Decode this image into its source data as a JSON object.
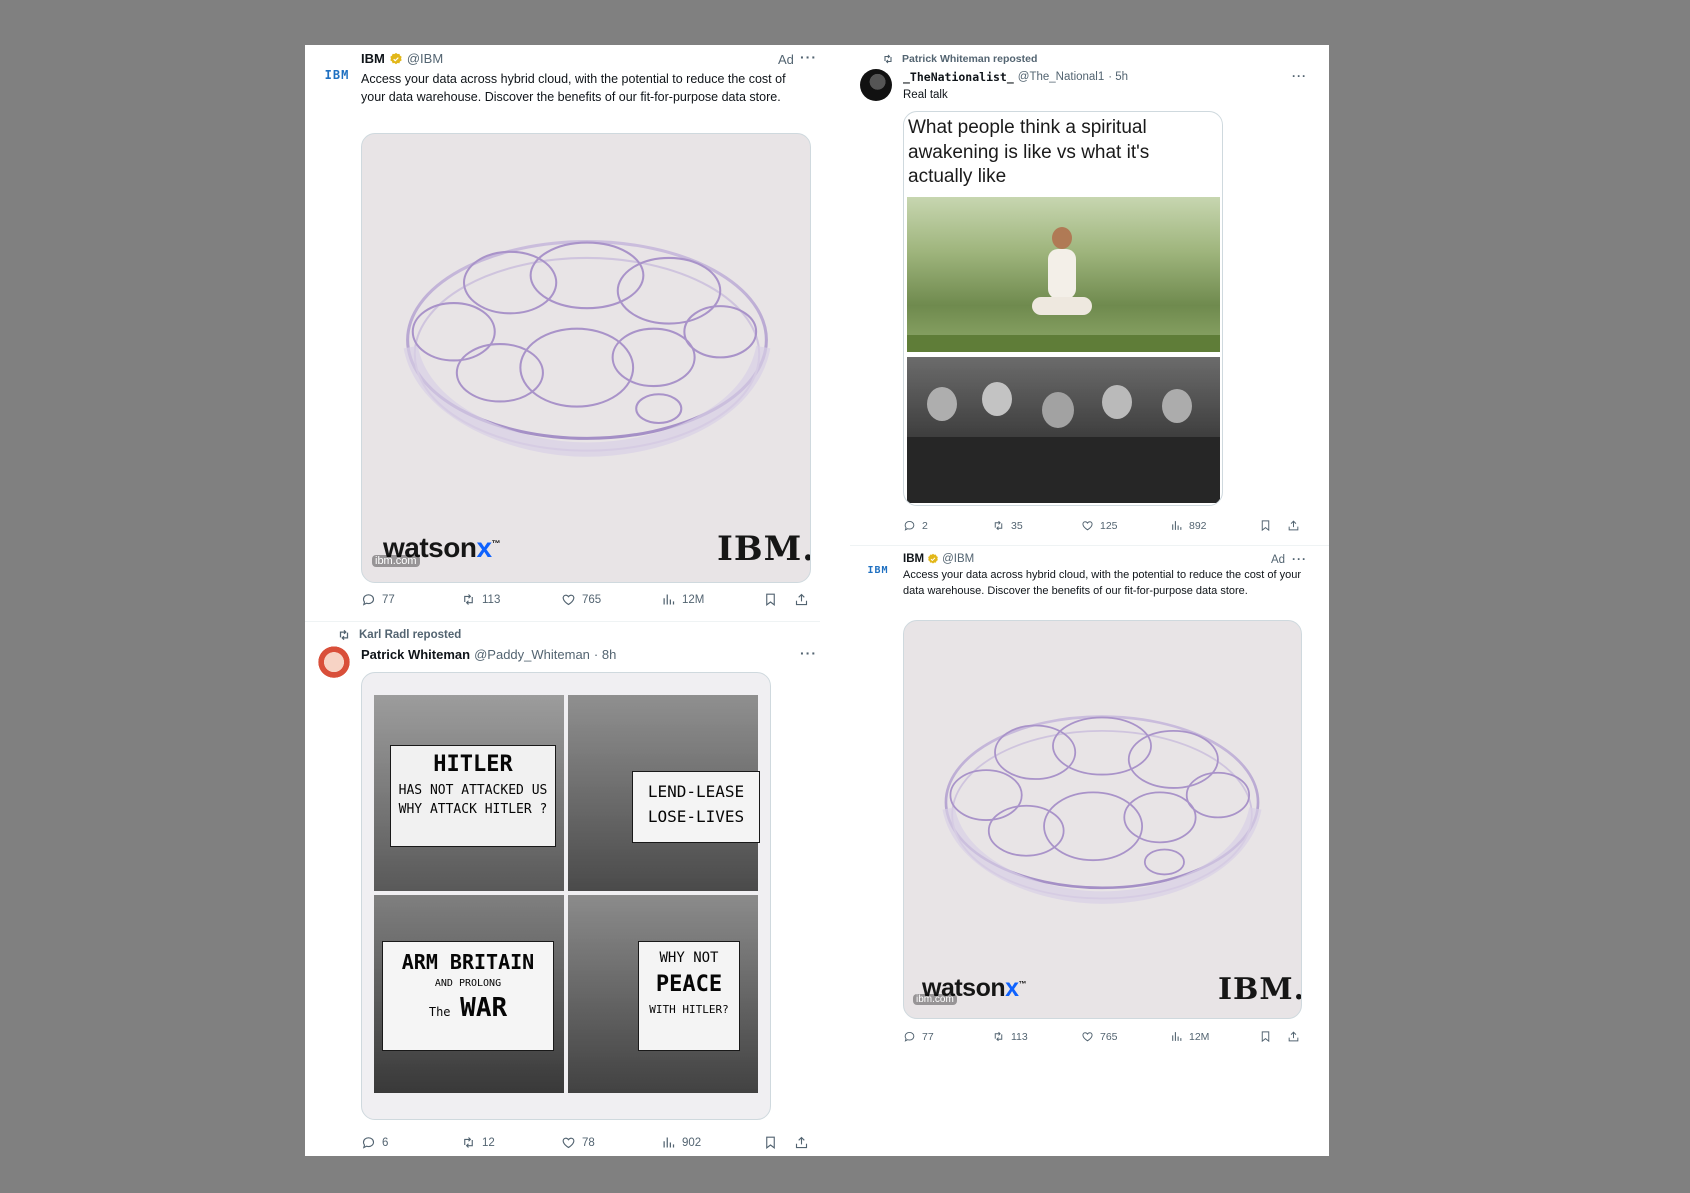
{
  "colors": {
    "background": "#808080",
    "ibm_blue": "#1f70c1",
    "verified_gold": "#e2b719",
    "watsonx_accent": "#0f62fe"
  },
  "left_col": {
    "ad1": {
      "avatar_text": "IBM",
      "name": "IBM",
      "handle": "@IBM",
      "ad_label": "Ad",
      "more": "···",
      "text": "Access your data across hybrid cloud, with the potential to reduce the cost of your data warehouse. Discover the benefits of our fit-for-purpose data store.",
      "media": {
        "brand": "watson",
        "brand_x": "x",
        "tm": "™",
        "logo": "IBM.",
        "domain": "ibm.com"
      },
      "stats": {
        "replies": "77",
        "reposts": "113",
        "likes": "765",
        "views": "12M"
      }
    },
    "post2": {
      "repost_note": "Karl Radl reposted",
      "name": "Patrick Whiteman",
      "handle": "@Paddy_Whiteman",
      "time": "· 8h",
      "more": "···",
      "signs": [
        [
          "HITLER",
          "HAS NOT ATTACKED US",
          "WHY ATTACK HITLER ?"
        ],
        [
          "LEND-LEASE",
          "LOSE-LIVES"
        ],
        [
          "ARM BRITAIN",
          "AND PROLONG",
          "The",
          "WAR"
        ],
        [
          "WHY NOT",
          "PEACE",
          "WITH HITLER?"
        ]
      ],
      "stats": {
        "replies": "6",
        "reposts": "12",
        "likes": "78",
        "views": "902"
      }
    }
  },
  "right_col": {
    "post1": {
      "repost_note": "Patrick Whiteman reposted",
      "name": "_TheNationalist_",
      "handle": "@The_National1",
      "time": "· 5h",
      "more": "···",
      "text": "Real talk",
      "meme_caption": "What people think a spiritual awakening is like vs what it's actually like",
      "stats": {
        "replies": "2",
        "reposts": "35",
        "likes": "125",
        "views": "892"
      }
    },
    "ad2": {
      "avatar_text": "IBM",
      "name": "IBM",
      "handle": "@IBM",
      "ad_label": "Ad",
      "more": "···",
      "text": "Access your data across hybrid cloud, with the potential to reduce the cost of your data warehouse. Discover the benefits of our fit-for-purpose data store.",
      "media": {
        "brand": "watson",
        "brand_x": "x",
        "tm": "™",
        "logo": "IBM.",
        "domain": "ibm.com"
      },
      "stats": {
        "replies": "77",
        "reposts": "113",
        "likes": "765",
        "views": "12M"
      }
    }
  }
}
